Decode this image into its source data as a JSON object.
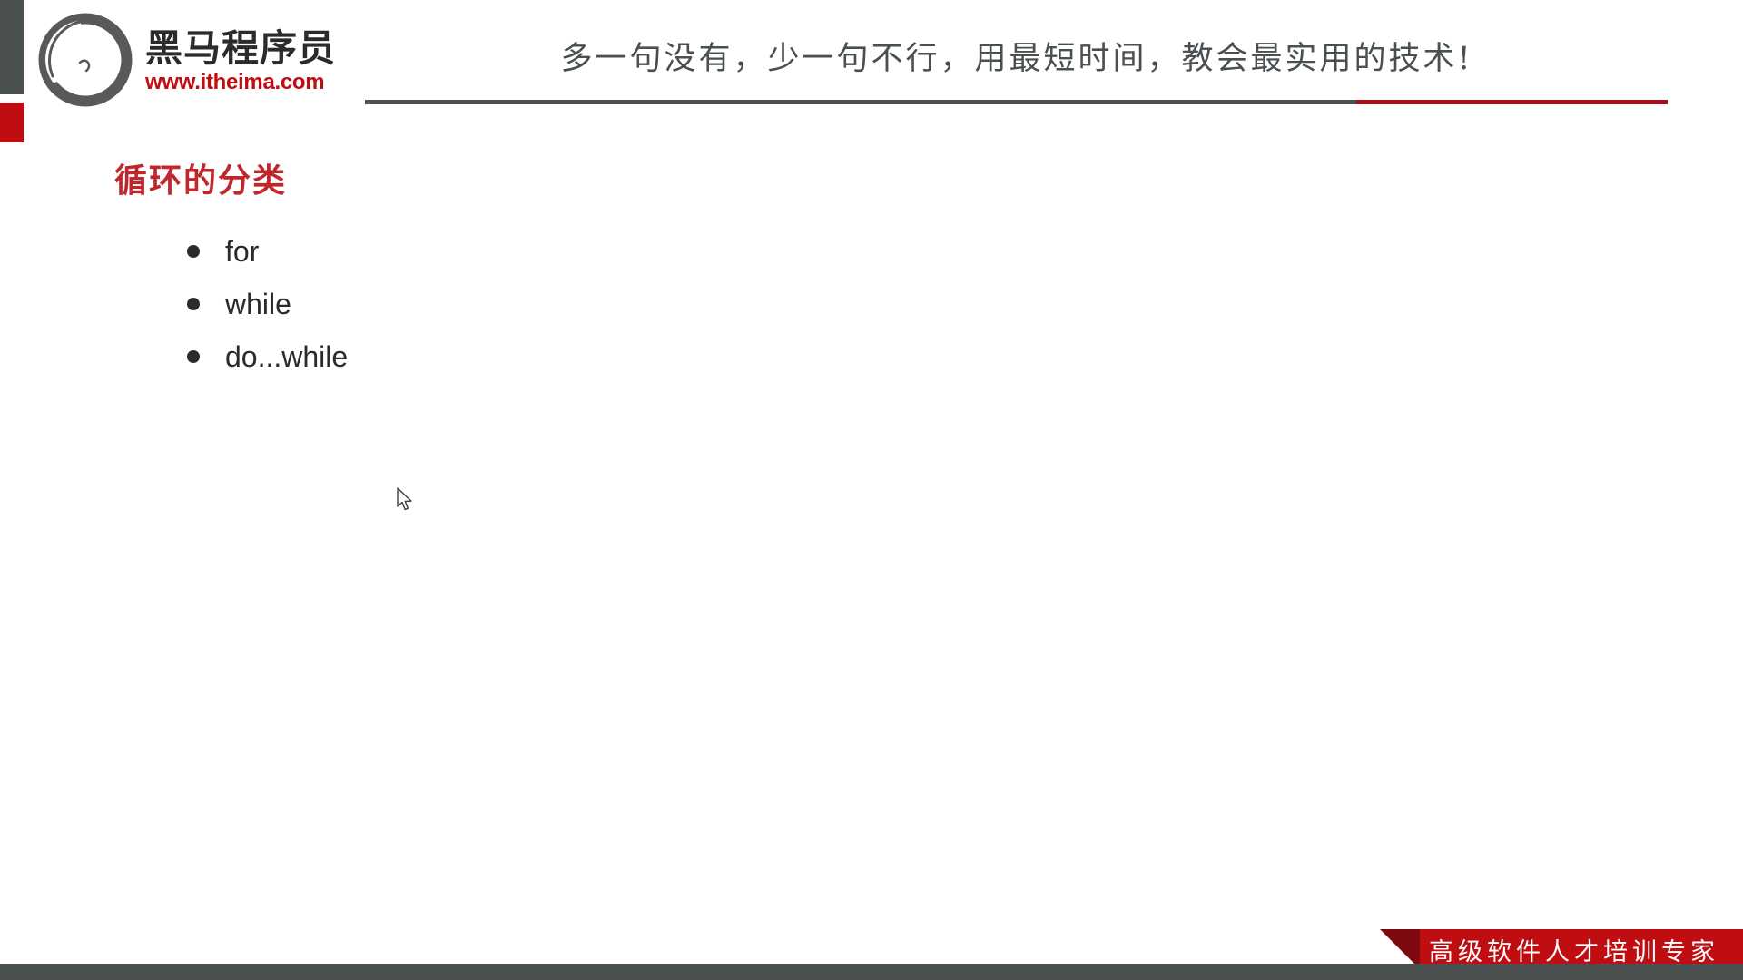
{
  "header": {
    "logo": {
      "icon": "horse-head-circle-logo",
      "brand_cn": "黑马程序员",
      "url": "www.itheima.com"
    },
    "slogan": "多一句没有，少一句不行，用最短时间，教会最实用的技术!",
    "rule": {
      "gray_color": "#4b5150",
      "red_color": "#a5111a"
    }
  },
  "slide": {
    "title": "循环的分类",
    "title_color": "#c0272d",
    "bullets": [
      {
        "label": "for"
      },
      {
        "label": "while"
      },
      {
        "label": "do...while"
      }
    ]
  },
  "banner": {
    "text": "高级软件人才培训专家",
    "background": "#c00d12",
    "fold_color": "#7e0a10"
  },
  "decor": {
    "edge_bar_gray": "#4b5150",
    "edge_bar_red": "#c00d12",
    "bottom_bar": "#4b5150"
  },
  "cursor": {
    "icon": "mouse-pointer-arrow"
  }
}
